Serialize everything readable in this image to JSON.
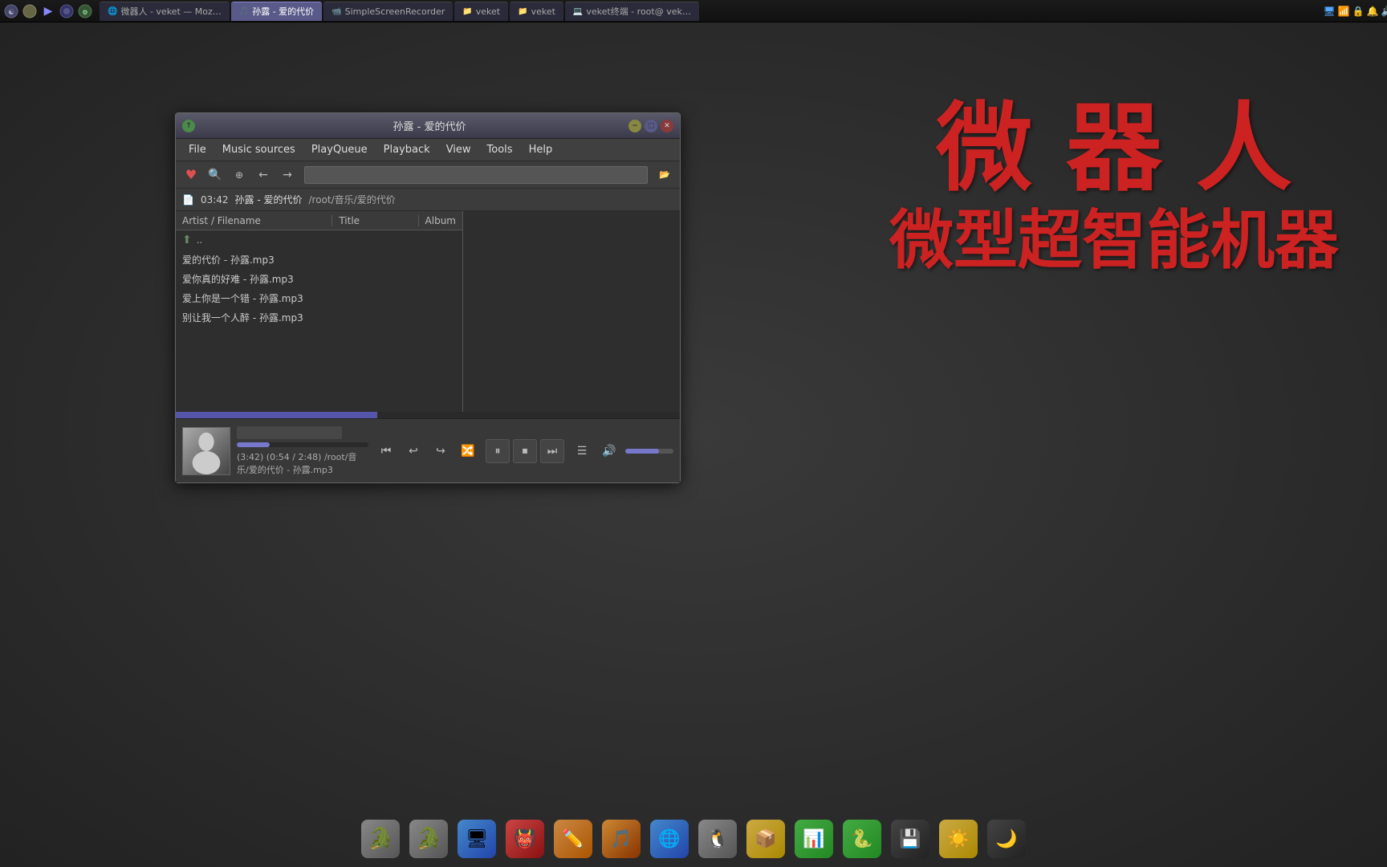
{
  "desktop": {
    "background_color": "#2a2a2a"
  },
  "taskbar_top": {
    "tabs": [
      {
        "label": "微器人 - veket — Moz…",
        "active": false
      },
      {
        "label": "孙露 - 爱的代价",
        "active": true
      },
      {
        "label": "SimpleScreenRecorder",
        "active": false
      },
      {
        "label": "veket",
        "active": false
      },
      {
        "label": "veket",
        "active": false
      },
      {
        "label": "veket终端 - root@ vek…",
        "active": false
      }
    ],
    "tray_items": [
      "network",
      "battery",
      "volume",
      "clock"
    ]
  },
  "watermark": {
    "line1": "微 器 人",
    "line2": "微型超智能机器"
  },
  "player_window": {
    "title": "孙露 - 爱的代价",
    "menu": {
      "items": [
        "File",
        "Music sources",
        "PlayQueue",
        "Playback",
        "View",
        "Tools",
        "Help"
      ]
    },
    "toolbar": {
      "heart_label": "♥",
      "search_placeholder": "",
      "browse_icon": "🔍",
      "back_icon": "←",
      "forward_icon": "→"
    },
    "now_playing": {
      "time": "03:42",
      "artist": "孙露 - 爱的代价",
      "path": "/root/音乐/爱的代价"
    },
    "file_list": {
      "columns": [
        "Artist / Filename",
        "Title",
        "Album"
      ],
      "items": [
        {
          "name": "..",
          "is_parent": true
        },
        {
          "name": "爱的代价 - 孙露.mp3",
          "is_parent": false
        },
        {
          "name": "爱你真的好难 - 孙露.mp3",
          "is_parent": false
        },
        {
          "name": "爱上你是一个错 - 孙露.mp3",
          "is_parent": false
        },
        {
          "name": "别让我一个人醉 - 孙露.mp3",
          "is_parent": false
        }
      ]
    },
    "progress": {
      "current": "0:54",
      "total": "2:48",
      "total_alt": "3:42",
      "path": "/root/音乐/爱的代价 - 孙露.mp3",
      "percent": 25
    },
    "bottom_status": "(3:42)  (0:54 / 2:48) /root/音乐/爱的代价 - 孙露.mp3"
  },
  "dock": {
    "items": [
      {
        "icon": "🐊",
        "label": "file-manager-1",
        "color": "gray"
      },
      {
        "icon": "🐊",
        "label": "file-manager-2",
        "color": "gray"
      },
      {
        "icon": "💻",
        "label": "system",
        "color": "blue"
      },
      {
        "icon": "😈",
        "label": "app1",
        "color": "red"
      },
      {
        "icon": "✏️",
        "label": "draw",
        "color": "orange"
      },
      {
        "icon": "🎵",
        "label": "music",
        "color": "orange"
      },
      {
        "icon": "🌐",
        "label": "browser",
        "color": "blue"
      },
      {
        "icon": "🐧",
        "label": "linux",
        "color": "gray"
      },
      {
        "icon": "📦",
        "label": "packages",
        "color": "yellow"
      },
      {
        "icon": "📊",
        "label": "charts",
        "color": "green"
      },
      {
        "icon": "🐍",
        "label": "python",
        "color": "green"
      },
      {
        "icon": "💾",
        "label": "storage",
        "color": "dark"
      },
      {
        "icon": "☀️",
        "label": "settings",
        "color": "yellow"
      },
      {
        "icon": "🌙",
        "label": "theme",
        "color": "dark"
      }
    ]
  }
}
